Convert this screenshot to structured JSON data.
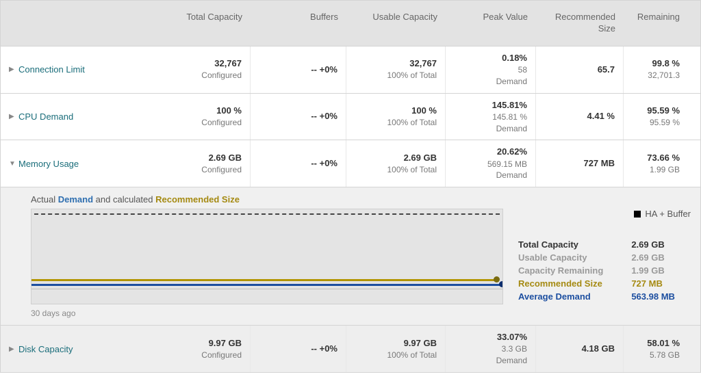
{
  "headers": {
    "total_capacity": "Total Capacity",
    "buffers": "Buffers",
    "usable_capacity": "Usable Capacity",
    "peak_value": "Peak Value",
    "recommended_size_l1": "Recommended",
    "recommended_size_l2": "Size",
    "remaining": "Remaining"
  },
  "rows": {
    "connection_limit": {
      "label": "Connection Limit",
      "total_value": "32,767",
      "total_sub": "Configured",
      "buffers": "-- +0%",
      "usable_value": "32,767",
      "usable_sub": "100% of Total",
      "peak_pct": "0.18%",
      "peak_val": "58",
      "peak_sub": "Demand",
      "recommended": "65.7",
      "remaining_pct": "99.8 %",
      "remaining_val": "32,701.3"
    },
    "cpu_demand": {
      "label": "CPU Demand",
      "total_value": "100 %",
      "total_sub": "Configured",
      "buffers": "-- +0%",
      "usable_value": "100 %",
      "usable_sub": "100% of Total",
      "peak_pct": "145.81%",
      "peak_val": "145.81 %",
      "peak_sub": "Demand",
      "recommended": "4.41 %",
      "remaining_pct": "95.59 %",
      "remaining_val": "95.59 %"
    },
    "memory_usage": {
      "label": "Memory Usage",
      "total_value": "2.69 GB",
      "total_sub": "Configured",
      "buffers": "-- +0%",
      "usable_value": "2.69 GB",
      "usable_sub": "100% of Total",
      "peak_pct": "20.62%",
      "peak_val": "569.15 MB",
      "peak_sub": "Demand",
      "recommended": "727 MB",
      "remaining_pct": "73.66 %",
      "remaining_val": "1.99 GB"
    },
    "disk_capacity": {
      "label": "Disk Capacity",
      "total_value": "9.97 GB",
      "total_sub": "Configured",
      "buffers": "-- +0%",
      "usable_value": "9.97 GB",
      "usable_sub": "100% of Total",
      "peak_pct": "33.07%",
      "peak_val": "3.3 GB",
      "peak_sub": "Demand",
      "recommended": "4.18 GB",
      "remaining_pct": "58.01 %",
      "remaining_val": "5.78 GB"
    }
  },
  "expand": {
    "title_prefix": "Actual ",
    "title_demand": "Demand",
    "title_mid": " and calculated ",
    "title_recsize": "Recommended Size",
    "legend_ha": "  HA + Buffer",
    "caption": "30 days ago",
    "stats": {
      "total_capacity_k": "Total Capacity",
      "total_capacity_v": "2.69 GB",
      "usable_capacity_k": "Usable Capacity",
      "usable_capacity_v": "2.69 GB",
      "capacity_remaining_k": "Capacity Remaining",
      "capacity_remaining_v": "1.99 GB",
      "recommended_size_k": "Recommended Size",
      "recommended_size_v": "727 MB",
      "average_demand_k": "Average Demand",
      "average_demand_v": "563.98 MB"
    }
  },
  "chart_data": {
    "type": "line",
    "x_range_label": "30 days ago",
    "series": [
      {
        "name": "HA + Buffer (Total Capacity)",
        "style": "dashed-black",
        "value_gb": 2.69,
        "rel_y": 0.04
      },
      {
        "name": "Recommended Size",
        "style": "solid-gold",
        "value_mb": 727,
        "rel_y": 0.73
      },
      {
        "name": "Average Demand",
        "style": "solid-blue",
        "value_mb": 563.98,
        "rel_y": 0.78
      }
    ],
    "ylim_gb": [
      0,
      2.69
    ],
    "title": "Actual Demand and calculated Recommended Size"
  }
}
